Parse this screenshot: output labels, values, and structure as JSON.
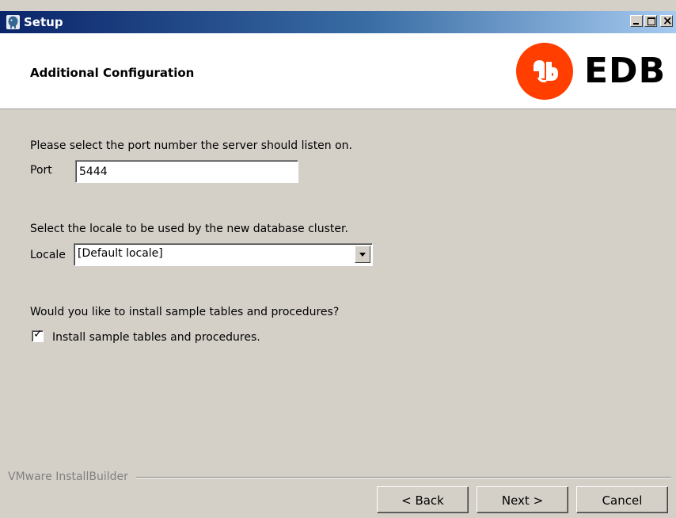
{
  "window": {
    "title": "Setup",
    "icon": "postgres-elephant-icon"
  },
  "header": {
    "title": "Additional Configuration",
    "logo_text": "EDB",
    "logo_color": "#ff3e00"
  },
  "port_section": {
    "prompt": "Please select the port number the server should listen on.",
    "label": "Port",
    "value": "5444"
  },
  "locale_section": {
    "prompt": "Select the locale to be used by the new database cluster.",
    "label": "Locale",
    "selected": "[Default locale]"
  },
  "sample_section": {
    "prompt": "Would you like to install sample tables and procedures?",
    "checkbox_label": "Install sample tables and procedures.",
    "checked": true,
    "check_glyph": "✓"
  },
  "footer": {
    "brand": "VMware InstallBuilder",
    "back_label": "< Back",
    "next_label": "Next >",
    "cancel_label": "Cancel"
  }
}
